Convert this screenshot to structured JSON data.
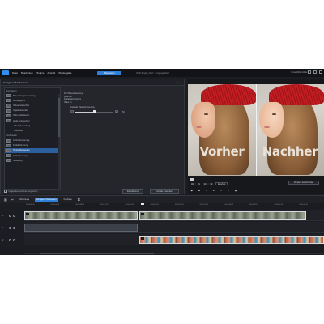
{
  "menubar": {
    "items": [
      "Datei",
      "Bearbeiten",
      "Plugins",
      "Ansicht",
      "Wiedergabe"
    ],
    "mode_button": "Bearbeiten",
    "document_title": "DVD-Projekt_Neu* - Ungespeichert",
    "user": "Gina Müller-Meier"
  },
  "panel": {
    "title": "Korrigieren/Verbessern",
    "groups": [
      {
        "label": "Korrigieren",
        "items": [
          {
            "label": "Beleuchtungsanpassung",
            "active": false,
            "indent": false
          },
          {
            "label": "Weißabgleich",
            "active": false,
            "indent": false
          },
          {
            "label": "Videoentrauschen",
            "active": false,
            "indent": false
          },
          {
            "label": "Objektivkorrektur",
            "active": false,
            "indent": false
          },
          {
            "label": "Video stabilisieren",
            "active": false,
            "indent": false
          },
          {
            "label": "Audio entrauschen",
            "active": false,
            "indent": false
          },
          {
            "label": "Wiederherstellung",
            "active": false,
            "indent": true
          },
          {
            "label": "Stabilisator",
            "active": false,
            "indent": true
          }
        ]
      },
      {
        "label": "Verbessern",
        "items": [
          {
            "label": "Farbverbesserung",
            "active": false,
            "indent": false
          },
          {
            "label": "Farbabstimmung",
            "active": false,
            "indent": false
          },
          {
            "label": "Hautverbesserung",
            "active": true,
            "indent": false
          },
          {
            "label": "Farbanpassung",
            "active": false,
            "indent": false
          },
          {
            "label": "Schärfung",
            "active": false,
            "indent": false
          }
        ]
      }
    ],
    "description": "Die Hautverbesserung passt die Farbabstimmung im Video an.",
    "slider": {
      "label": "Grad der Hautverbesserung",
      "value": 50,
      "value_text": "50"
    },
    "checkbox_label": "Im geteilten Vorschau vergleichen",
    "reset_button": "Zurücksetzen",
    "apply_all_button": "Auf alle anwenden"
  },
  "preview": {
    "caption_before": "Vorher",
    "caption_after": "Nachher",
    "timecode": "00 : 00 : 00 : 00",
    "quality": "Ergebnis",
    "compare_button": "Rendern der Vorschau",
    "controls": [
      "play-icon",
      "stop-icon",
      "prev-frame-icon",
      "next-frame-icon",
      "fullscreen-icon",
      "volume-icon",
      "snapshot-icon"
    ]
  },
  "timeline": {
    "toolbar": {
      "tools_dropdown": "Werkzeuge",
      "active_tab": "Korrigieren/Verbessern",
      "keyframe": "Keyframe"
    },
    "ruler_ticks": [
      "00:00:00:00",
      "00:00:04:04",
      "00:00:08:08",
      "00:00:12:12",
      "00:00:16:16",
      "00:00:20:20",
      "00:00:25:00",
      "00:00:29:04",
      "00:00:33:08",
      "00:00:37:12",
      "00:00:41:16",
      "00:00:45:20"
    ],
    "tracks": [
      {
        "number": "1"
      },
      {
        "number": "1"
      },
      {
        "number": "2"
      }
    ]
  },
  "colors": {
    "accent": "#2e7fd8",
    "selected": "#2c5f9e",
    "background": "#1b1d22"
  }
}
